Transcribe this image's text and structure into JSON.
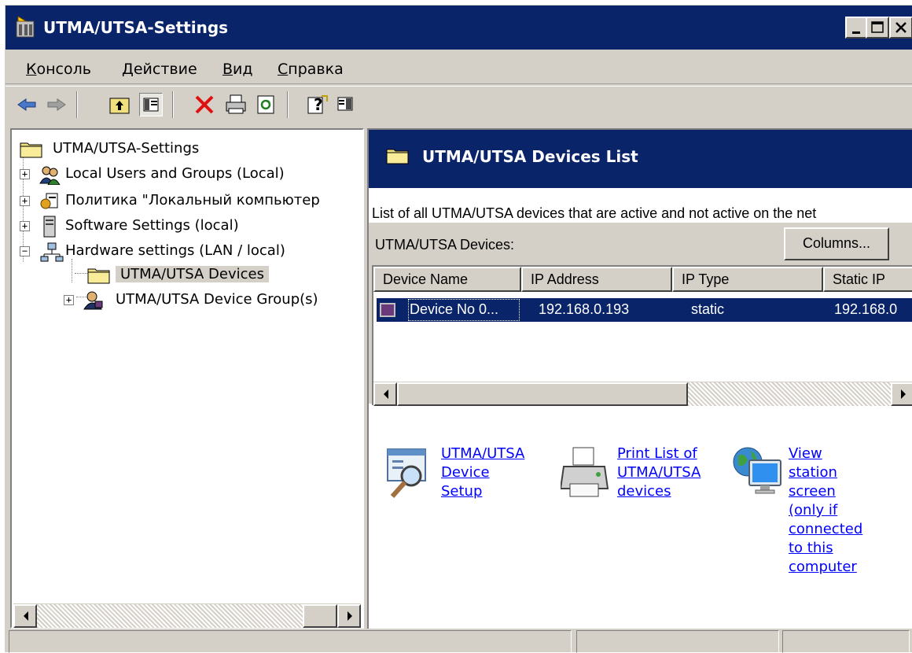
{
  "window": {
    "title": "UTMA/UTSA-Settings"
  },
  "menu": [
    {
      "label": "Консоль",
      "accel": "К",
      "rest": "онсоль"
    },
    {
      "label": "Действие",
      "accel": "Д",
      "rest": "ействие"
    },
    {
      "label": "Вид",
      "accel": "В",
      "rest": "ид"
    },
    {
      "label": "Справка",
      "accel": "С",
      "rest": "правка"
    }
  ],
  "toolbar": {
    "icons": [
      "back-arrow-icon",
      "forward-arrow-icon",
      "up-folder-icon",
      "show-hide-tree-icon",
      "delete-icon",
      "print-icon",
      "refresh-icon",
      "help-icon",
      "action-pane-icon"
    ]
  },
  "tree": {
    "items": [
      {
        "label": "UTMA/UTSA-Settings",
        "icon": "folder-icon"
      },
      {
        "label": "Local Users and Groups (Local)",
        "icon": "users-groups-icon"
      },
      {
        "label": "Политика \"Локальный компьютер",
        "icon": "policy-icon"
      },
      {
        "label": "Software Settings (local)",
        "icon": "software-icon"
      },
      {
        "label": "Hardware settings (LAN / local)",
        "icon": "network-icon"
      },
      {
        "label": "UTMA/UTSA Devices",
        "icon": "folder-icon"
      },
      {
        "label": "UTMA/UTSA Device Group(s)",
        "icon": "device-group-icon"
      }
    ]
  },
  "pane": {
    "header_title": "UTMA/UTSA Devices List",
    "description": "List of all UTMA/UTSA devices that are active and not active on the net",
    "devices_label": "UTMA/UTSA Devices:",
    "columns_button": "Columns...",
    "columns": [
      "Device Name",
      "IP Address",
      "IP Type",
      "Static IP"
    ],
    "rows": [
      {
        "device_name": "Device No  0...",
        "ip_address": "192.168.0.193",
        "ip_type": "static",
        "static_ip": "192.168.0"
      }
    ]
  },
  "tasks": [
    {
      "label": "UTMA/UTSA\nDevice\nSetup",
      "icon": "device-setup-icon"
    },
    {
      "label": "Print List of\nUTMA/UTSA\ndevices",
      "icon": "printer-icon"
    },
    {
      "label": "View\nstation\nscreen\n(only if\nconnected\nto this\ncomputer",
      "icon": "view-screen-icon"
    }
  ],
  "colors": {
    "title_bar": "#0a246a",
    "selection": "#0a246a",
    "face": "#d4d0c8",
    "link": "#0000ff"
  }
}
